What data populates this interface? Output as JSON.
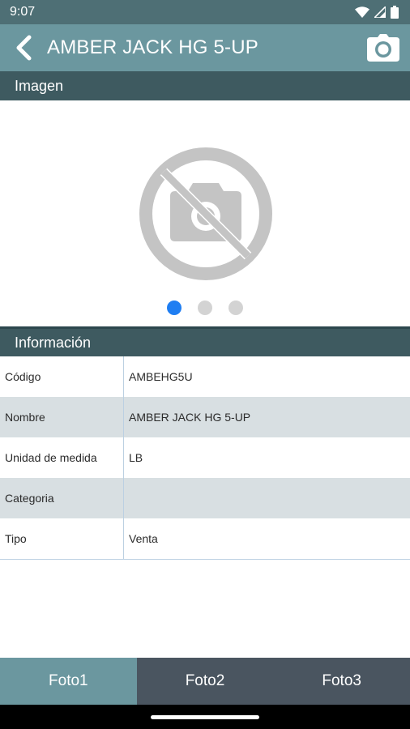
{
  "status_bar": {
    "time": "9:07"
  },
  "app_bar": {
    "title": "AMBER JACK HG 5-UP"
  },
  "sections": {
    "image": "Imagen",
    "info": "Información"
  },
  "carousel": {
    "page_count": 3,
    "active_index": 0
  },
  "info_rows": [
    {
      "label": "Código",
      "value": "AMBEHG5U"
    },
    {
      "label": "Nombre",
      "value": "AMBER JACK HG 5-UP"
    },
    {
      "label": "Unidad de medida",
      "value": "LB"
    },
    {
      "label": "Categoria",
      "value": ""
    },
    {
      "label": "Tipo",
      "value": "Venta"
    }
  ],
  "tabs": [
    {
      "label": "Foto1",
      "active": true
    },
    {
      "label": "Foto2",
      "active": false
    },
    {
      "label": "Foto3",
      "active": false
    }
  ],
  "colors": {
    "status_bar": "#4e6f75",
    "app_bar": "#6b979f",
    "section_header": "#3e5a60",
    "active_dot": "#1f7ef2",
    "inactive_tab": "#4a5560"
  }
}
